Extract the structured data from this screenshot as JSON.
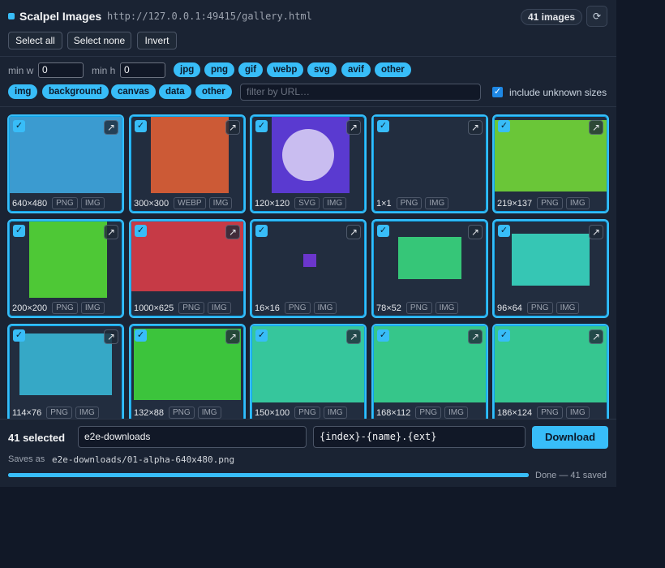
{
  "header": {
    "title": "Scalpel Images",
    "url": "http://127.0.0.1:49415/gallery.html",
    "count_badge": "41 images",
    "refresh_icon": "refresh-icon",
    "refresh_glyph": "⟳"
  },
  "selection": {
    "select_all": "Select all",
    "select_none": "Select none",
    "invert": "Invert"
  },
  "filters": {
    "min_w_label": "min w",
    "min_w_value": "0",
    "min_h_label": "min h",
    "min_h_value": "0",
    "type_chips": [
      "jpg",
      "png",
      "gif",
      "webp",
      "svg",
      "avif",
      "other"
    ],
    "source_chips": [
      "img",
      "background",
      "canvas",
      "data",
      "other"
    ],
    "url_placeholder": "filter by URL…",
    "include_unknown_label": "include unknown sizes",
    "include_unknown_checked": true
  },
  "check_glyph": "✓",
  "open_glyph": "↗",
  "accent_color": "#38bdf8",
  "cards": [
    {
      "dims": "640×480",
      "format": "PNG",
      "source": "IMG",
      "color": "#3b9bd0",
      "shape": "rect"
    },
    {
      "dims": "300×300",
      "format": "WEBP",
      "source": "IMG",
      "color": "#cc5a36",
      "shape": "rect"
    },
    {
      "dims": "120×120",
      "format": "SVG",
      "source": "IMG",
      "color": "#5a3ad0",
      "shape": "circle",
      "fg": "#c9bdf0"
    },
    {
      "dims": "1×1",
      "format": "PNG",
      "source": "IMG",
      "color": "#222d3f",
      "shape": "rect"
    },
    {
      "dims": "219×137",
      "format": "PNG",
      "source": "IMG",
      "color": "#6ac638",
      "shape": "rect"
    },
    {
      "dims": "200×200",
      "format": "PNG",
      "source": "IMG",
      "color": "#4ec836",
      "shape": "rect"
    },
    {
      "dims": "1000×625",
      "format": "PNG",
      "source": "IMG",
      "color": "#c63a46",
      "shape": "rect"
    },
    {
      "dims": "16×16",
      "format": "PNG",
      "source": "IMG",
      "color": "#6b36cc",
      "shape": "rect"
    },
    {
      "dims": "78×52",
      "format": "PNG",
      "source": "IMG",
      "color": "#36c678",
      "shape": "rect"
    },
    {
      "dims": "96×64",
      "format": "PNG",
      "source": "IMG",
      "color": "#36c6b4",
      "shape": "rect"
    },
    {
      "dims": "114×76",
      "format": "PNG",
      "source": "IMG",
      "color": "#36a8c6",
      "shape": "rect"
    },
    {
      "dims": "132×88",
      "format": "PNG",
      "source": "IMG",
      "color": "#3cc43c",
      "shape": "rect"
    },
    {
      "dims": "150×100",
      "format": "PNG",
      "source": "IMG",
      "color": "#36c69c",
      "shape": "rect"
    },
    {
      "dims": "168×112",
      "format": "PNG",
      "source": "IMG",
      "color": "#36c68a",
      "shape": "rect"
    },
    {
      "dims": "186×124",
      "format": "PNG",
      "source": "IMG",
      "color": "#36c690",
      "shape": "rect"
    }
  ],
  "footer": {
    "selected_count": "41 selected",
    "folder_value": "e2e-downloads",
    "pattern_value": "{index}-{name}.{ext}",
    "download_label": "Download",
    "saves_as_label": "Saves as",
    "saves_as_path": "e2e-downloads/01-alpha-640x480.png",
    "progress_fraction": 1.0,
    "status": "Done — 41 saved"
  }
}
